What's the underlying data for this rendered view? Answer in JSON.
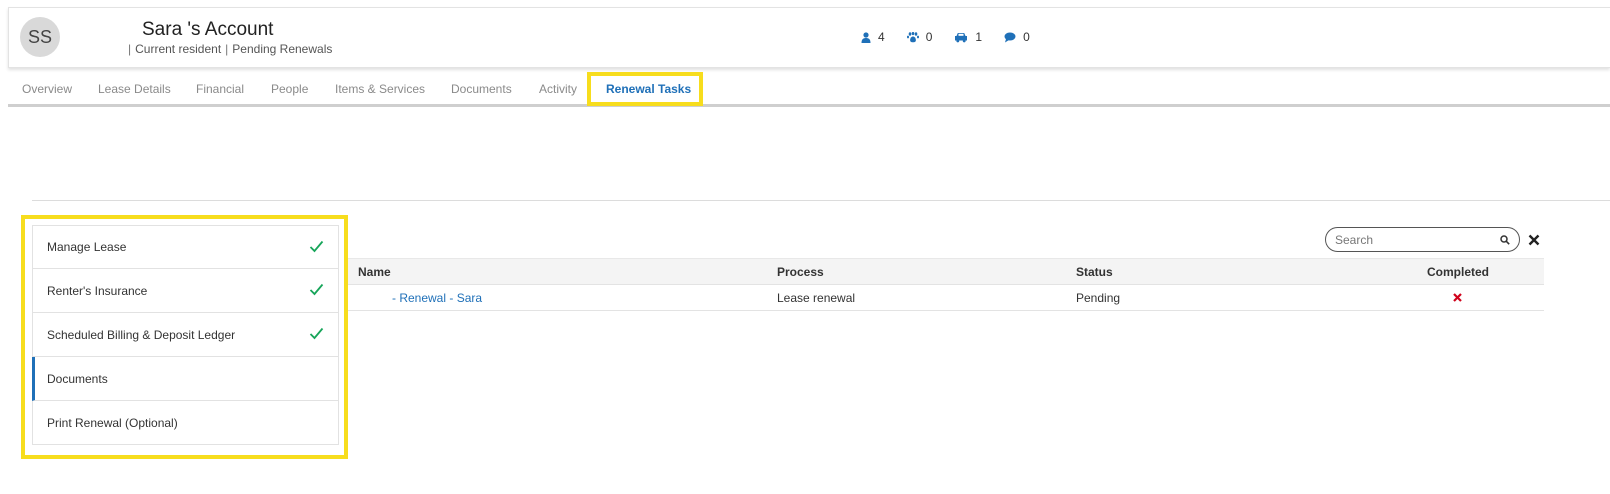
{
  "header": {
    "initials": "SS",
    "title": "Sara 's Account",
    "sub_sep": "|",
    "status": "Current resident",
    "stage": "Pending Renewals",
    "counts": [
      {
        "icon": "people-icon",
        "value": "4"
      },
      {
        "icon": "paw-icon",
        "value": "0"
      },
      {
        "icon": "car-icon",
        "value": "1"
      },
      {
        "icon": "comment-icon",
        "value": "0"
      }
    ]
  },
  "tabs": [
    {
      "label": "Overview"
    },
    {
      "label": "Lease Details"
    },
    {
      "label": "Financial"
    },
    {
      "label": "People"
    },
    {
      "label": "Items & Services"
    },
    {
      "label": "Documents"
    },
    {
      "label": "Activity"
    },
    {
      "label": "Renewal Tasks",
      "active": true
    }
  ],
  "tasks": [
    {
      "label": "Manage Lease",
      "done": true
    },
    {
      "label": "Renter's Insurance",
      "done": true
    },
    {
      "label": "Scheduled Billing & Deposit Ledger",
      "done": true
    },
    {
      "label": "Documents",
      "done": false,
      "active": true
    },
    {
      "label": "Print Renewal (Optional)",
      "done": false
    }
  ],
  "search": {
    "placeholder": "Search",
    "value": ""
  },
  "table": {
    "columns": [
      "Name",
      "Process",
      "Status",
      "Completed"
    ],
    "rows": [
      {
        "name": "- Renewal - Sara",
        "process": "Lease renewal",
        "status": "Pending",
        "completed": false
      }
    ]
  },
  "colors": {
    "accent": "#1f70b8",
    "highlight": "#f7dd1d",
    "check": "#17a55a",
    "cross": "#d0021b"
  }
}
